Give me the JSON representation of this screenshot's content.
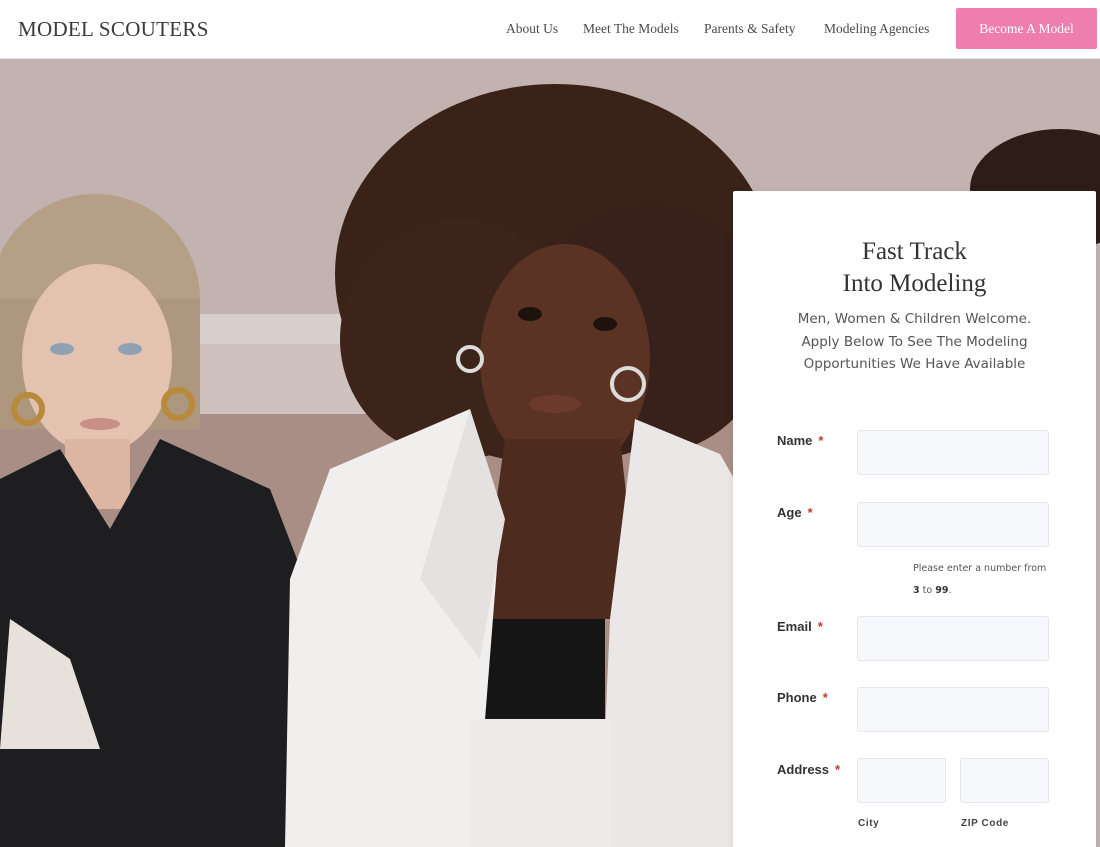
{
  "header": {
    "logo": "MODEL SCOUTERS",
    "nav": [
      "About Us",
      "Meet The Models",
      "Parents & Safety",
      "Modeling Agencies"
    ],
    "cta": "Become A Model"
  },
  "colors": {
    "accent": "#ee7eb0",
    "required": "#c0392b"
  },
  "form": {
    "title_line1": "Fast Track",
    "title_line2": "Into Modeling",
    "subtitle_line1": "Men, Women & Children Welcome.",
    "subtitle_line2": "Apply Below To See The Modeling",
    "subtitle_line3": "Opportunities We Have Available",
    "required_mark": "*",
    "fields": {
      "name": {
        "label": "Name",
        "value": ""
      },
      "age": {
        "label": "Age",
        "value": ""
      },
      "email": {
        "label": "Email",
        "value": ""
      },
      "phone": {
        "label": "Phone",
        "value": ""
      },
      "address": {
        "label": "Address"
      }
    },
    "age_hint": {
      "prefix": "Please enter a number from",
      "min": "3",
      "to": "to",
      "max": "99",
      "suffix": "."
    },
    "address_sublabels": {
      "city": "City",
      "zip": "ZIP Code"
    }
  }
}
